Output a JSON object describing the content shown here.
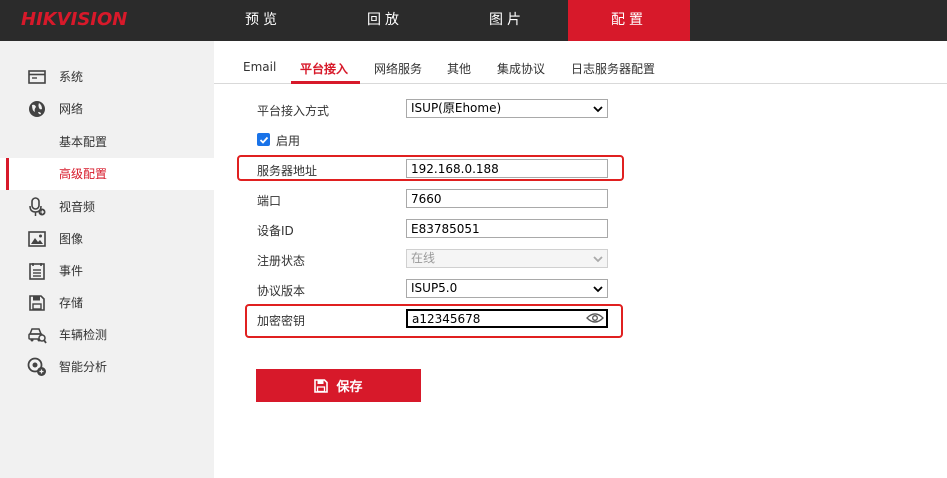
{
  "brand": {
    "logo_red": "HIK",
    "logo_white": "VISION"
  },
  "nav": [
    {
      "label": "预览"
    },
    {
      "label": "回放"
    },
    {
      "label": "图片"
    },
    {
      "label": "配置"
    }
  ],
  "sidebar": {
    "items": [
      {
        "label": "系统",
        "icon": "window-icon"
      },
      {
        "label": "网络",
        "icon": "globe-icon"
      },
      {
        "label": "基本配置",
        "icon": ""
      },
      {
        "label": "高级配置",
        "icon": ""
      },
      {
        "label": "视音频",
        "icon": "microphone-icon"
      },
      {
        "label": "图像",
        "icon": "image-icon"
      },
      {
        "label": "事件",
        "icon": "event-list-icon"
      },
      {
        "label": "存储",
        "icon": "floppy-icon"
      },
      {
        "label": "车辆检测",
        "icon": "vehicle-search-icon"
      },
      {
        "label": "智能分析",
        "icon": "smart-analysis-icon"
      }
    ]
  },
  "tabs": [
    {
      "label": "Email"
    },
    {
      "label": "平台接入"
    },
    {
      "label": "网络服务"
    },
    {
      "label": "其他"
    },
    {
      "label": "集成协议"
    },
    {
      "label": "日志服务器配置"
    }
  ],
  "form": {
    "access_mode": {
      "label": "平台接入方式",
      "value": "ISUP(原Ehome)"
    },
    "enable": {
      "label": "启用",
      "checked": true
    },
    "server_address": {
      "label": "服务器地址",
      "value": "192.168.0.188"
    },
    "port": {
      "label": "端口",
      "value": "7660"
    },
    "device_id": {
      "label": "设备ID",
      "value": "E83785051"
    },
    "register_status": {
      "label": "注册状态",
      "value": "在线"
    },
    "protocol_version": {
      "label": "协议版本",
      "value": "ISUP5.0"
    },
    "encryption_key": {
      "label": "加密密钥",
      "value": "a12345678"
    }
  },
  "save_button": {
    "label": "保存"
  },
  "colors": {
    "accent": "#d7192a",
    "topbar": "#2b2b2b",
    "sidebar": "#f1f1f1",
    "highlight": "#e02020",
    "checkbox": "#1a73e8"
  }
}
